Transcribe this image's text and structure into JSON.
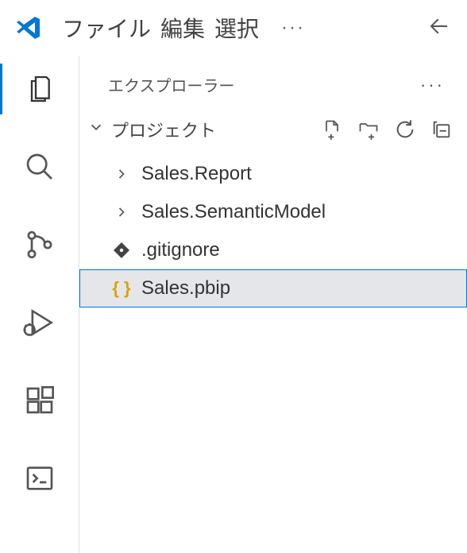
{
  "menu": {
    "file": "ファイル",
    "edit": "編集",
    "select": "選択",
    "ellipsis": "···"
  },
  "sidebar": {
    "title": "エクスプローラー",
    "actions_ellipsis": "···"
  },
  "section": {
    "title": "プロジェクト"
  },
  "tree": {
    "items": [
      {
        "label": "Sales.Report"
      },
      {
        "label": "Sales.SemanticModel"
      },
      {
        "label": ".gitignore"
      },
      {
        "label": "Sales.pbip"
      }
    ]
  }
}
